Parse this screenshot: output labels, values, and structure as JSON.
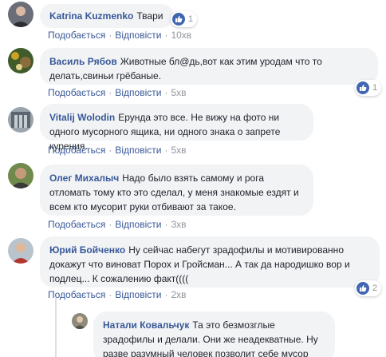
{
  "comments": [
    {
      "author": "Katrina Kuzmenko",
      "text": "Твари",
      "like_label": "Подобається",
      "reply_label": "Відповісти",
      "time": "10хв",
      "reactions": "1"
    },
    {
      "author": "Василь Рябов",
      "text": "Животные бл@дь,вот как этим уродам что то делать,свиньи грёбаные.",
      "like_label": "Подобається",
      "reply_label": "Відповісти",
      "time": "5хв",
      "reactions": "1"
    },
    {
      "author": "Vitalij Wolodin",
      "text": "Ерунда это все. Не вижу на фото ни одного мусорного ящика, ни одного знака о запрете курения.",
      "like_label": "Подобається",
      "reply_label": "Відповісти",
      "time": "5хв"
    },
    {
      "author": "Олег Михалыч",
      "text": "Надо было взять самому и рога отломать тому кто это сделал, у меня знакомые ездят и всем кто мусорит руки отбивают за такое.",
      "like_label": "Подобається",
      "reply_label": "Відповісти",
      "time": "3хв"
    },
    {
      "author": "Юрий Бойченко",
      "text": "Ну сейчас набегут зрадофилы и мотивированно докажут что виноват Порох и Гройсман... А так да народишко вор и подлец... К сожалению факт((((",
      "like_label": "Подобається",
      "reply_label": "Відповісти",
      "time": "2хв",
      "reactions": "2"
    }
  ],
  "reply": {
    "author": "Натали Ковальчук",
    "text": "Та это безмозглые зрадофилы и делали. Они же неадекватные. Ну разве разумный человек позволит себе мусор бросать на пол?!"
  },
  "colors": {
    "link": "#385898",
    "bubble": "#f2f3f5",
    "meta": "#90949c",
    "like": "#4267b2"
  },
  "icons": [
    "thumbs-up-icon",
    "avatar"
  ]
}
